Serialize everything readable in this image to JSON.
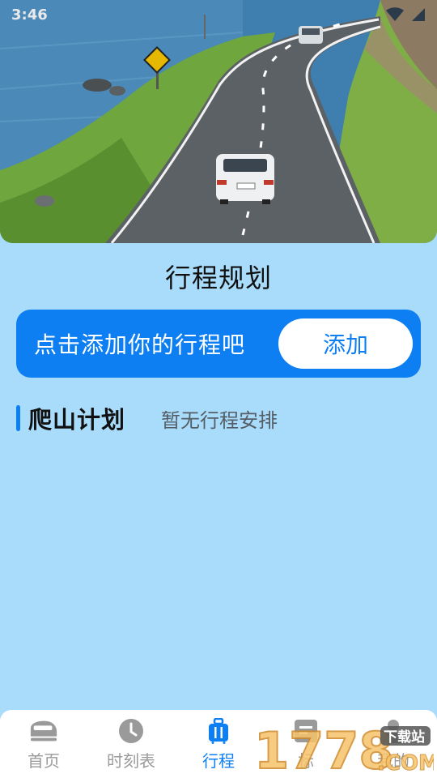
{
  "status_bar": {
    "time": "3:46"
  },
  "page": {
    "title": "行程规划"
  },
  "add_card": {
    "prompt": "点击添加你的行程吧",
    "button_label": "添加"
  },
  "plan": {
    "title": "爬山计划",
    "empty_text": "暂无行程安排"
  },
  "tabs": [
    {
      "label": "首页",
      "icon": "train-icon",
      "active": false
    },
    {
      "label": "时刻表",
      "icon": "clock-icon",
      "active": false
    },
    {
      "label": "行程",
      "icon": "luggage-icon",
      "active": true
    },
    {
      "label": "标",
      "icon": "ticket-icon",
      "active": false
    },
    {
      "label": "我的",
      "icon": "person-icon",
      "active": false
    }
  ],
  "watermark": {
    "text": "1778",
    "subtext": "下载站",
    "suffix": ".COM"
  },
  "colors": {
    "accent": "#0d7ff2",
    "background": "#a9dcfb",
    "inactive": "#9a9a9a"
  }
}
